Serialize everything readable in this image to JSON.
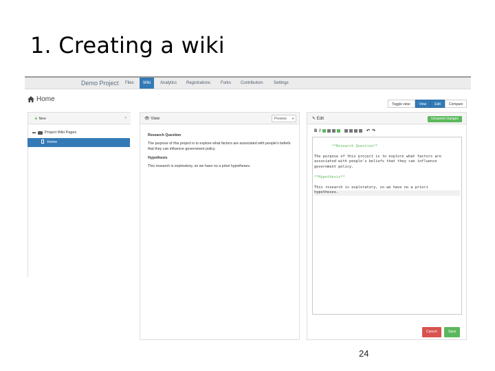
{
  "slide": {
    "title": "1. Creating a wiki",
    "page_number": "24"
  },
  "navbar": {
    "brand": "Demo Project",
    "items": [
      {
        "label": "Files"
      },
      {
        "label": "Wiki",
        "active": true
      },
      {
        "label": "Analytics"
      },
      {
        "label": "Registrations"
      },
      {
        "label": "Forks"
      },
      {
        "label": "Contributors"
      },
      {
        "label": "Settings"
      }
    ]
  },
  "page": {
    "heading": "Home",
    "toggle_label": "Toggle view:",
    "view_label": "View",
    "edit_label": "Edit",
    "compare_label": "Compare"
  },
  "sidebar": {
    "new_label": "New",
    "collapse": "‹",
    "root_label": "Project Wiki Pages",
    "selected_page": "Home"
  },
  "view_panel": {
    "title": "View",
    "select_value": "Preview",
    "heading1": "Research Question",
    "para1": "The purpose of this project is to explore what factors are associated with people's beliefs that they can influence government policy.",
    "heading2": "Hypothesis",
    "para2": "This research is exploratory, so we have no a priori hypotheses."
  },
  "edit_panel": {
    "title": "Edit",
    "unsaved_label": "Unsaved changes",
    "toolbar": [
      "B",
      "I"
    ],
    "text_lines": [
      "**Research Question**",
      "",
      "The purpose of this project is to explore what factors are",
      "associated with people's beliefs that they can influence",
      "government policy.",
      "",
      "**Hypothesis**",
      "",
      "This research is exploratory, so we have no a priori",
      "hypotheses."
    ],
    "cancel_label": "Cancel",
    "save_label": "Save"
  },
  "colors": {
    "primary": "#337ab7",
    "success": "#5cb85c",
    "danger": "#d9534f"
  }
}
